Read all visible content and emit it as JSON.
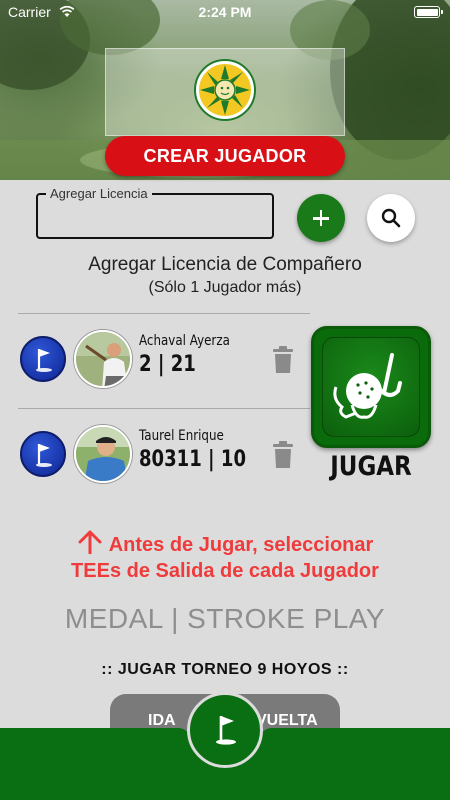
{
  "status_bar": {
    "carrier": "Carrier",
    "time": "2:24 PM"
  },
  "header": {
    "create_player_label": "CREAR JUGADOR"
  },
  "license": {
    "legend": "Agregar Licencia",
    "value": ""
  },
  "companion": {
    "title": "Agregar Licencia de Compañero",
    "subtitle": "(Sólo 1 Jugador más)"
  },
  "players": [
    {
      "name": "Achaval Ayerza",
      "info": "2 | 21"
    },
    {
      "name": "Taurel Enrique",
      "info": "80311 | 10"
    }
  ],
  "play": {
    "label": "JUGAR"
  },
  "warning": {
    "line1": "Antes de Jugar, seleccionar",
    "line2": "TEEs de Salida de cada Jugador"
  },
  "mode": "MEDAL | STROKE PLAY",
  "torneo": ":: JUGAR TORNEO 9 HOYOS ::",
  "segments": {
    "ida": "IDA",
    "vuelta": "VUELTA"
  },
  "colors": {
    "brand_green": "#0a6e12",
    "create_red": "#d90f16",
    "warning_red": "#ef3b3b",
    "tee_blue": "#1834a8"
  },
  "icons": [
    "wifi-icon",
    "battery-icon",
    "club-logo",
    "plus-icon",
    "search-icon",
    "golf-flag-icon",
    "avatar",
    "trash-icon",
    "golf-ball-club-icon",
    "up-arrow-icon"
  ]
}
